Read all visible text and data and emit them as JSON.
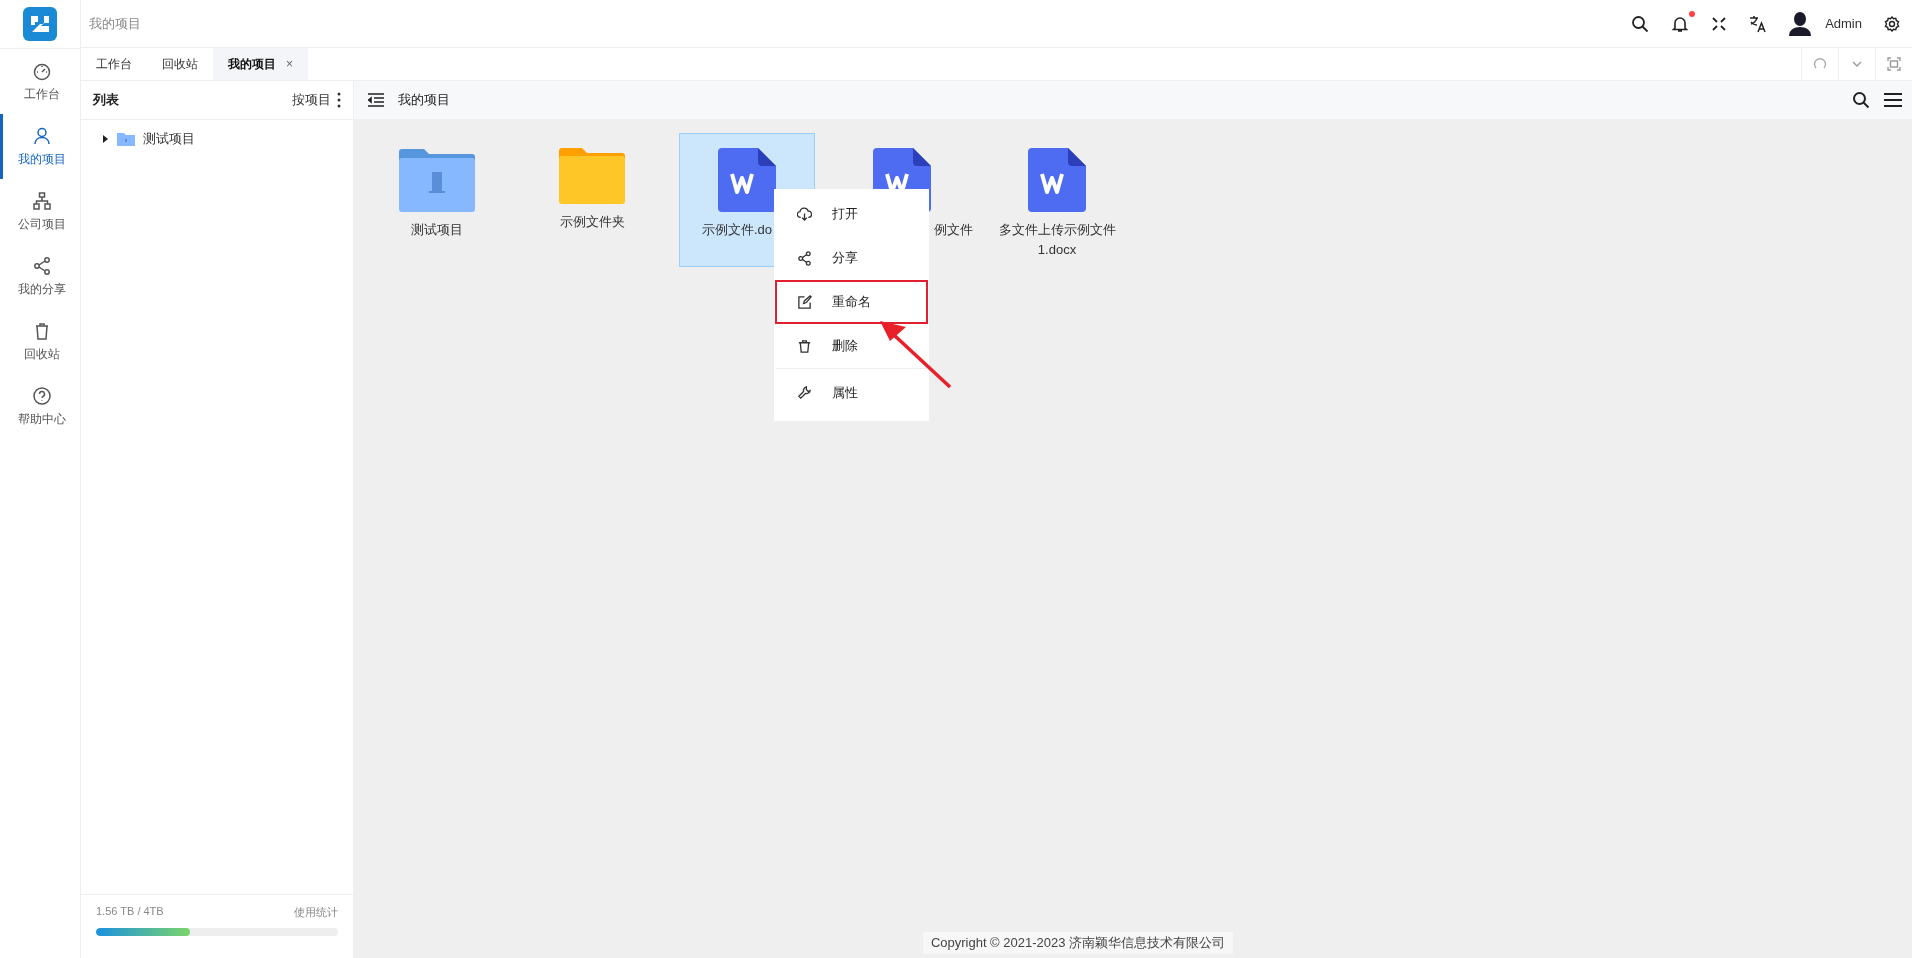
{
  "header": {
    "breadcrumb": "我的项目",
    "user": "Admin",
    "notification_dot": true
  },
  "nav": [
    {
      "label": "工作台",
      "kind": "gauge",
      "selected": false
    },
    {
      "label": "我的项目",
      "kind": "person",
      "selected": true
    },
    {
      "label": "公司项目",
      "kind": "org",
      "selected": false
    },
    {
      "label": "我的分享",
      "kind": "share",
      "selected": false
    },
    {
      "label": "回收站",
      "kind": "trash",
      "selected": false
    },
    {
      "label": "帮助中心",
      "kind": "help",
      "selected": false
    }
  ],
  "tabs": [
    {
      "label": "工作台",
      "selected": false
    },
    {
      "label": "回收站",
      "selected": false
    },
    {
      "label": "我的项目",
      "selected": true,
      "close": "×"
    }
  ],
  "panel": {
    "title": "列表",
    "sort": "按项目",
    "tree": [
      {
        "label": "测试项目",
        "expanded": false
      }
    ],
    "usage": "1.56 TB / 4TB",
    "usage_link": "使用统计",
    "level": 0.39
  },
  "content": {
    "title": "我的项目",
    "files": [
      {
        "name": "测试项目",
        "kind": "project",
        "selected": false
      },
      {
        "name": "示例文件夹",
        "kind": "folder",
        "selected": false
      },
      {
        "name": "示例文件.do",
        "kind": "word",
        "selected": true,
        "clipped_end": true
      },
      {
        "name": "例文件",
        "kind": "word",
        "selected": false,
        "clipped_start": true
      },
      {
        "name": "多文件上传示例文件1.docx",
        "kind": "word",
        "selected": false
      }
    ]
  },
  "context_menu": [
    {
      "label": "打开",
      "kind": "download",
      "highlighted": false
    },
    {
      "label": "分享",
      "kind": "share",
      "highlighted": false
    },
    {
      "label": "重命名",
      "kind": "edit",
      "highlighted": true
    },
    {
      "label": "删除",
      "kind": "trash",
      "highlighted": false
    },
    {
      "label": "属性",
      "kind": "wrench",
      "highlighted": false
    }
  ],
  "footer": "Copyright © 2021-2023 济南颖华信息技术有限公司"
}
